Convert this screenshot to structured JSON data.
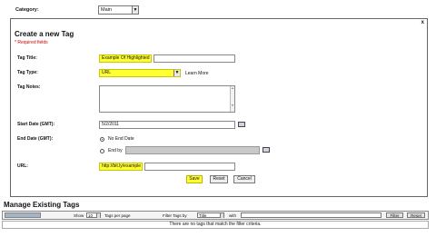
{
  "category": {
    "label": "Category:",
    "value": "Main"
  },
  "form": {
    "close_label": "x",
    "title": "Create a new Tag",
    "required_note": "* Required fields",
    "tag_title": {
      "label": "Tag Title:",
      "value": "Example Of Highlighted"
    },
    "tag_type": {
      "label": "Tag Type:",
      "value": "URL",
      "learn_more": "Learn More"
    },
    "tag_notes": {
      "label": "Tag Notes:",
      "scroll_up": "▲",
      "scroll_down": "▼"
    },
    "start_date": {
      "label": "Start Date (GMT):",
      "value": "5/2/2011"
    },
    "end_date": {
      "label": "End Date (GMT):",
      "no_end_date": "No End Date",
      "end_by": "End by"
    },
    "url": {
      "label": "URL:",
      "value": "http://bit.ly/example"
    },
    "buttons": {
      "save": "Save",
      "reset": "Reset",
      "cancel": "Cancel"
    }
  },
  "manage": {
    "title": "Manage Existing Tags",
    "show_label": "Show",
    "show_value": "10",
    "tags_per_page": "Tags per page",
    "filter_label": "Filter Tags by",
    "filter_value": "Title",
    "with_label": "with",
    "filter_button": "Filter",
    "reset_button": "Reset",
    "empty_message": "There are no tags that match the filter criteria."
  }
}
